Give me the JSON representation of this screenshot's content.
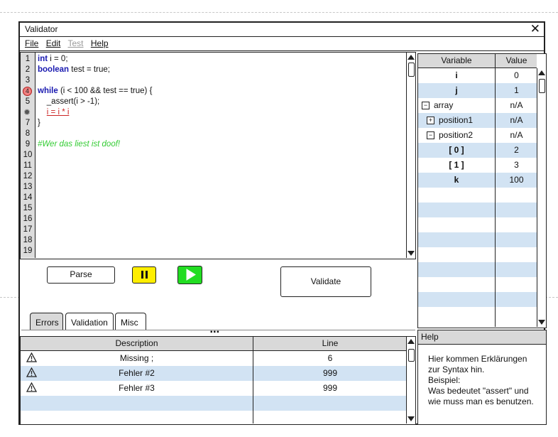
{
  "window": {
    "title": "Validator"
  },
  "menu": [
    {
      "label": "File",
      "disabled": false
    },
    {
      "label": "Edit",
      "disabled": false
    },
    {
      "label": "Test",
      "disabled": true
    },
    {
      "label": "Help",
      "disabled": false
    }
  ],
  "editor": {
    "line_numbers": [
      "1",
      "2",
      "3",
      "4",
      "5",
      "6",
      "7",
      "8",
      "9",
      "10",
      "11",
      "12",
      "13",
      "14",
      "15",
      "16",
      "17",
      "18",
      "19"
    ],
    "breakpoint_label": "4",
    "lines": {
      "l1_kw": "int",
      "l1_rest": " i = 0;",
      "l2_kw": "boolean",
      "l2_rest": " test = true;",
      "l4_kw": "while",
      "l4_rest": " (i < 100 && test == true) {",
      "l5": "    _assert(i > -1);",
      "l6_indent": "    ",
      "l6_err": "i = i * i",
      "l7": "}",
      "l9": "#Wer das liest ist doof!"
    }
  },
  "buttons": {
    "parse": "Parse",
    "pause_icon": "pause-icon",
    "play_icon": "play-icon",
    "validate": "Validate",
    "pause_color": "#ffee00",
    "play_color": "#22dd22"
  },
  "tabs": [
    "Errors",
    "Validation",
    "Misc"
  ],
  "errors": {
    "headers": {
      "description": "Description",
      "line": "Line"
    },
    "rows": [
      {
        "icon": "warning-icon",
        "description": "Missing ;",
        "line": "6"
      },
      {
        "icon": "warning-icon",
        "description": "Fehler #2",
        "line": "999"
      },
      {
        "icon": "warning-icon",
        "description": "Fehler #3",
        "line": "999"
      }
    ]
  },
  "variables": {
    "headers": {
      "variable": "Variable",
      "value": "Value"
    },
    "rows": [
      {
        "name": "i",
        "value": "0",
        "style": "bold-center"
      },
      {
        "name": "j",
        "value": "1",
        "style": "bold-center"
      },
      {
        "name": "array",
        "value": "n/A",
        "tree": "minus"
      },
      {
        "name": "position1",
        "value": "n/A",
        "tree": "plus"
      },
      {
        "name": "position2",
        "value": "n/A",
        "tree": "minus"
      },
      {
        "name": "[ 0 ]",
        "value": "2",
        "style": "bold-center"
      },
      {
        "name": "[ 1 ]",
        "value": "3",
        "style": "bold-center"
      },
      {
        "name": "k",
        "value": "100",
        "style": "bold-center"
      }
    ]
  },
  "help": {
    "title": "Help",
    "lines": [
      "Hier kommen Erklärungen",
      "zur Syntax hin.",
      "Beispiel:",
      "Was bedeutet \"assert\" und",
      "wie muss man es benutzen."
    ]
  }
}
